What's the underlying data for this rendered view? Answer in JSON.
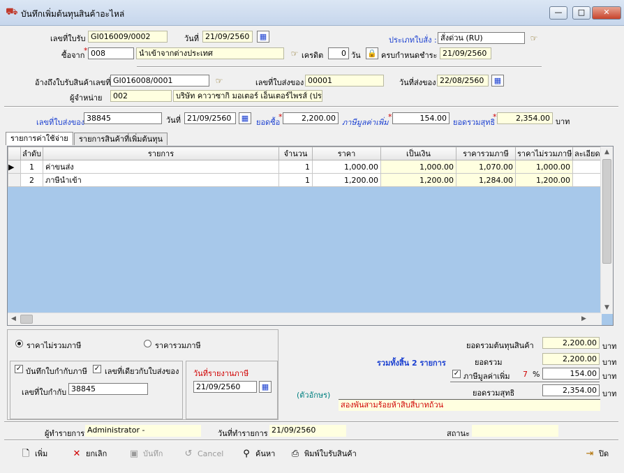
{
  "window": {
    "title": "บันทึกเพิ่มต้นทุนสินค้าอะไหล่",
    "minimize": "—",
    "maximize": "□",
    "close": "✕"
  },
  "header": {
    "receipt_no_label": "เลขที่ใบรับ",
    "receipt_no": "GI016009/0002",
    "date_label": "วันที่",
    "date": "21/09/2560",
    "order_type_label": "ประเภทใบสั่ง :",
    "order_type": "สั่งด่วน (RU)",
    "buy_from_label": "ซื้อจาก",
    "buy_from_code": "008",
    "buy_from_name": "นำเข้าจากต่างประเทศ",
    "credit_label": "เครดิต",
    "credit_days": "0",
    "days_label": "วัน",
    "due_label": "ครบกำหนดชำระ",
    "due_date": "21/09/2560",
    "ref_receipt_label": "อ้างถึงใบรับสินค้าเลขที่",
    "ref_receipt": "GI016008/0001",
    "delivery_no_label": "เลขที่ใบส่งของ",
    "delivery_no": "00001",
    "delivery_date_label": "วันที่ส่งของ",
    "delivery_date": "22/08/2560",
    "vendor_label": "ผู้จำหน่าย",
    "vendor_code": "002",
    "vendor_name": "บริษัท คาวาซากิ มอเตอร์ เอ็นเตอร์ไพรส์ (ประ"
  },
  "summary_bar": {
    "delivery_no_label": "เลขที่ใบส่งของ",
    "delivery_no": "38845",
    "date_label": "วันที่",
    "date": "21/09/2560",
    "purchase_label": "ยอดซื้อ",
    "purchase": "2,200.00",
    "vat_label": "ภาษีมูลค่าเพิ่ม",
    "vat": "154.00",
    "net_label": "ยอดรวมสุทธิ",
    "net": "2,354.00",
    "baht": "บาท"
  },
  "tabs": [
    "รายการค่าใช้จ่าย",
    "รายการสินค้าที่เพิ่มต้นทุน"
  ],
  "grid": {
    "columns": [
      "ลำดับ",
      "รายการ",
      "จำนวน",
      "ราคา",
      "เป็นเงิน",
      "ราคารวมภาษี",
      "ราคาไม่รวมภาษี",
      "ละเอียดเพิ่"
    ],
    "rows": [
      {
        "seq": "1",
        "item": "ค่าขนส่ง",
        "qty": "1",
        "price": "1,000.00",
        "amount": "1,000.00",
        "incl": "1,070.00",
        "excl": "1,000.00"
      },
      {
        "seq": "2",
        "item": "ภาษีนำเข้า",
        "qty": "1",
        "price": "1,200.00",
        "amount": "1,200.00",
        "incl": "1,284.00",
        "excl": "1,200.00"
      }
    ]
  },
  "options": {
    "price_excl_vat": "ราคาไม่รวมภาษี",
    "price_incl_vat": "ราคารวมภาษี",
    "save_tax_invoice": "บันทึกใบกำกับภาษี",
    "same_as_delivery": "เลขที่เดียวกับใบส่งของ",
    "tax_invoice_no_label": "เลขที่ใบกำกับ",
    "tax_invoice_no": "38845",
    "tax_report_date_label": "วันที่รายงานภาษี",
    "tax_report_date": "21/09/2560"
  },
  "totals": {
    "cost_total_label": "ยอดรวมต้นทุนสินค้า",
    "cost_total": "2,200.00",
    "items_summary": "รวมทั้งสิ้น 2 รายการ",
    "subtotal_label": "ยอดรวม",
    "subtotal": "2,200.00",
    "vat_label": "ภาษีมูลค่าเพิ่ม",
    "vat_rate": "7",
    "percent": "%",
    "vat": "154.00",
    "net_label": "ยอดรวมสุทธิ",
    "net": "2,354.00",
    "baht": "บาท",
    "in_words_label": "(ตัวอักษร)",
    "in_words": "สองพันสามร้อยห้าสิบสี่บาทถ้วน"
  },
  "status_bar": {
    "user_label": "ผู้ทำรายการ",
    "user": "Administrator -",
    "txn_date_label": "วันที่ทำรายการ",
    "txn_date": "21/09/2560",
    "status_label": "สถานะ",
    "status": ""
  },
  "toolbar": {
    "add": "เพิ่ม",
    "cancel_edit": "ยกเลิก",
    "save": "บันทึก",
    "cancel": "Cancel",
    "search": "ค้นหา",
    "print": "พิมพ์ใบรับสินค้า",
    "close": "ปิด"
  }
}
